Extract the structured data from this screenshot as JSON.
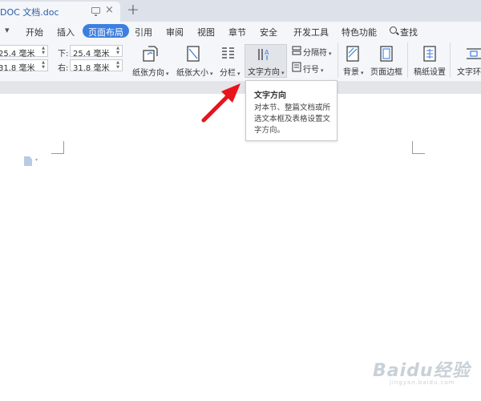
{
  "tabbar": {
    "doc_title": "DOC 文档.doc",
    "close_glyph": "×",
    "add_glyph": "+"
  },
  "menu": {
    "items": [
      "开始",
      "插入",
      "页面布局",
      "引用",
      "审阅",
      "视图",
      "章节",
      "安全",
      "开发工具",
      "特色功能"
    ],
    "active_item": "页面布局",
    "search_label": "查找",
    "active_color": "#3d7fe0"
  },
  "margins": {
    "top": {
      "label": "",
      "value": "25.4 毫米"
    },
    "left": {
      "label": "",
      "value": "31.8 毫米"
    },
    "bottom": {
      "label": "下:",
      "value": "25.4 毫米"
    },
    "right": {
      "label": "右:",
      "value": "31.8 毫米"
    }
  },
  "ribbon": {
    "orientation": "纸张方向",
    "size": "纸张大小",
    "columns": "分栏",
    "text_direction": "文字方向",
    "separator": "分隔符",
    "line_number": "行号",
    "background": "背景",
    "page_border": "页面边框",
    "manuscript": "稿纸设置",
    "text_wrap": "文字环绕"
  },
  "tooltip": {
    "title": "文字方向",
    "description": "对本节、整篇文档或所选文本框及表格设置文字方向。"
  },
  "annotation": {
    "arrow_color": "#e8131b"
  },
  "watermark": {
    "text": "Baidu经验",
    "sub": "jingyan.baidu.com"
  },
  "icons": [
    "search-icon",
    "monitor-icon",
    "close-icon",
    "add-tab-icon",
    "page-orientation-icon",
    "paper-size-icon",
    "columns-icon",
    "text-direction-icon",
    "separator-icon",
    "line-number-icon",
    "background-icon",
    "page-border-icon",
    "manuscript-icon",
    "text-wrap-icon",
    "document-icon",
    "red-arrow-icon"
  ]
}
